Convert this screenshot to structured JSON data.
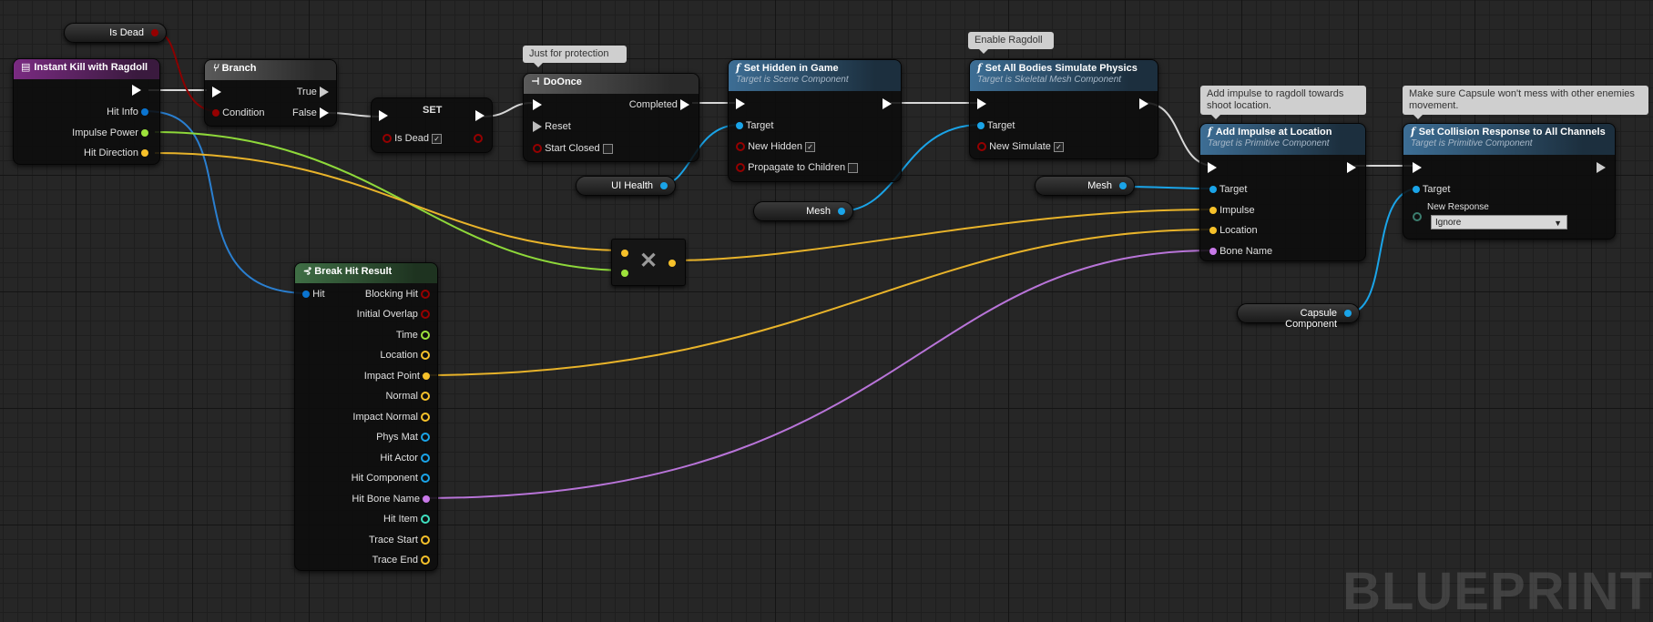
{
  "watermark": "BLUEPRINT",
  "colors": {
    "exec": "#ffffff",
    "bool": "#950000",
    "struct": "#0a74d0",
    "object": "#1aa4e8",
    "float": "#9ee23c",
    "vector": "#f6c12a",
    "name": "#c879e8",
    "int": "#3fe0c0",
    "byte": "#3b7d6e"
  },
  "getters": {
    "is_dead": "Is Dead",
    "ui_health": "UI Health",
    "mesh1": "Mesh",
    "mesh2": "Mesh",
    "capsule": "Capsule Component"
  },
  "comments": {
    "protection": "Just for protection",
    "ragdoll": "Enable Ragdoll",
    "impulse": "Add impulse to ragdoll towards shoot location.",
    "capsule": "Make sure Capsule won't mess with other enemies movement."
  },
  "event": {
    "title": "Instant Kill with Ragdoll",
    "pins": [
      "Hit Info",
      "Impulse Power",
      "Hit Direction"
    ]
  },
  "branch": {
    "title": "Branch",
    "condition": "Condition",
    "true": "True",
    "false": "False"
  },
  "set_node": {
    "title": "SET",
    "pin": "Is Dead"
  },
  "doonce": {
    "title": "DoOnce",
    "completed": "Completed",
    "reset": "Reset",
    "start_closed": "Start Closed"
  },
  "hidden": {
    "title": "Set Hidden in Game",
    "subtitle": "Target is Scene Component",
    "pins": [
      "Target",
      "New Hidden",
      "Propagate to Children"
    ]
  },
  "simulate": {
    "title": "Set All Bodies Simulate Physics",
    "subtitle": "Target is Skeletal Mesh Component",
    "pins": [
      "Target",
      "New Simulate"
    ]
  },
  "impulse": {
    "title": "Add Impulse at Location",
    "subtitle": "Target is Primitive Component",
    "pins": [
      "Target",
      "Impulse",
      "Location",
      "Bone Name"
    ]
  },
  "collision": {
    "title": "Set Collision Response to All Channels",
    "subtitle": "Target is Primitive Component",
    "pins": [
      "Target",
      "New Response"
    ],
    "response_value": "Ignore"
  },
  "break": {
    "title": "Break Hit Result",
    "input": "Hit",
    "outputs": [
      "Blocking Hit",
      "Initial Overlap",
      "Time",
      "Location",
      "Impact Point",
      "Normal",
      "Impact Normal",
      "Phys Mat",
      "Hit Actor",
      "Hit Component",
      "Hit Bone Name",
      "Hit Item",
      "Trace Start",
      "Trace End"
    ]
  },
  "multiply": {
    "symbol": "✕"
  }
}
